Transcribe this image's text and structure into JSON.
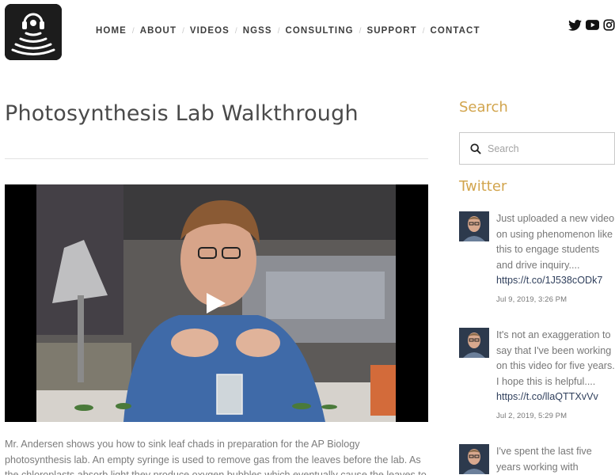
{
  "header": {
    "logo_name": "headphones-waves-logo",
    "nav": [
      "HOME",
      "ABOUT",
      "VIDEOS",
      "NGSS",
      "CONSULTING",
      "SUPPORT",
      "CONTACT"
    ],
    "social": [
      "twitter-icon",
      "youtube-icon",
      "instagram-icon"
    ]
  },
  "main": {
    "title": "Photosynthesis Lab Walkthrough",
    "video": {
      "play_icon": "play-icon"
    },
    "description": "Mr. Andersen shows you how to sink leaf chads in preparation for the AP Biology photosynthesis lab. An empty syringe is used to remove gas from the leaves before the lab. As the chloroplasts absorb light they produce oxygen bubbles which eventually cause the leaves to float."
  },
  "sidebar": {
    "search_heading": "Search",
    "search_placeholder": "Search",
    "twitter_heading": "Twitter",
    "tweets": [
      {
        "text": "Just uploaded a new video on using phenomenon like this to engage students and drive inquiry....",
        "link": "https://t.co/1J538cODk7",
        "date": "Jul 9, 2019, 3:26 PM"
      },
      {
        "text": "It's not an exaggeration to say that I've been working on this video for five years. I hope this is helpful....",
        "link": "https://t.co/llaQTTXvVv",
        "date": "Jul 2, 2019, 5:29 PM"
      },
      {
        "text": "I've spent the last five years working with",
        "link": "",
        "date": ""
      }
    ]
  },
  "colors": {
    "accent": "#d2a54e",
    "link": "#2f3f5c",
    "text": "#777777"
  }
}
